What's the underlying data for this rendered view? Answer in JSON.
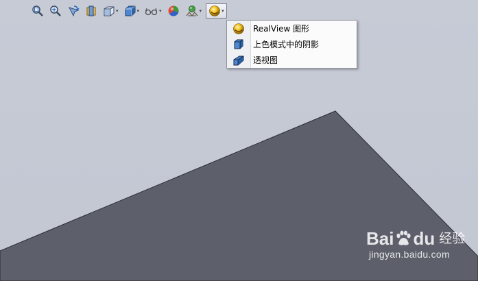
{
  "toolbar": {
    "buttons": [
      {
        "icon": "zoom-to-fit-icon",
        "has_dropdown": false
      },
      {
        "icon": "zoom-to-area-icon",
        "has_dropdown": false
      },
      {
        "icon": "previous-view-icon",
        "has_dropdown": false
      },
      {
        "icon": "section-view-icon",
        "has_dropdown": false
      },
      {
        "icon": "view-orientation-icon",
        "has_dropdown": true
      },
      {
        "icon": "display-style-icon",
        "has_dropdown": true
      },
      {
        "icon": "hide-show-items-icon",
        "has_dropdown": true
      },
      {
        "icon": "edit-appearance-icon",
        "has_dropdown": false
      },
      {
        "icon": "apply-scene-icon",
        "has_dropdown": true
      },
      {
        "icon": "view-settings-icon",
        "has_dropdown": true,
        "active": true
      }
    ],
    "dropdown_glyph": "▾"
  },
  "view_settings_menu": {
    "items": [
      {
        "label": "RealView 图形",
        "icon": "realview-sphere-icon"
      },
      {
        "label": "上色模式中的阴影",
        "icon": "shaded-cube-icon"
      },
      {
        "label": "透视图",
        "icon": "perspective-box-icon"
      }
    ]
  },
  "model": {
    "face_color": "#5d606b",
    "edge_color": "#2a2c33"
  },
  "watermark": {
    "brand": "Bai",
    "brand_suffix": "du",
    "brand_cn": "经验",
    "url": "jingyan.baidu.com"
  },
  "colors": {
    "background": "#c5c9d4",
    "menu_bg": "#fbfbfc",
    "menu_border": "#8e929b"
  }
}
